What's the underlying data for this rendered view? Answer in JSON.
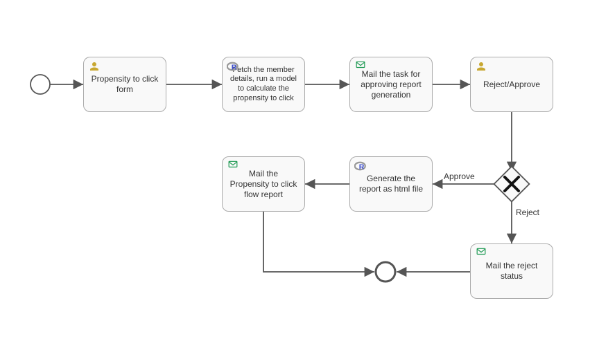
{
  "diagram_type": "BPMN",
  "tasks": {
    "t1": {
      "label": "Propensity to click form",
      "type": "user"
    },
    "t2": {
      "label": "Fetch the member details, run a model to calculate the propensity to click",
      "type": "r-script"
    },
    "t3": {
      "label": "Mail the task for approving report generation",
      "type": "mail"
    },
    "t4": {
      "label": "Reject/Approve",
      "type": "user"
    },
    "t5": {
      "label": "Generate the report as html file",
      "type": "r-script"
    },
    "t6": {
      "label": "Mail the Propensity to click flow report",
      "type": "mail"
    },
    "t7": {
      "label": "Mail the reject status",
      "type": "mail"
    }
  },
  "gateway_branches": {
    "approve": "Approve",
    "reject": "Reject"
  },
  "icons": {
    "user": "user-icon",
    "mail": "mail-icon",
    "rscript": "r-icon"
  }
}
